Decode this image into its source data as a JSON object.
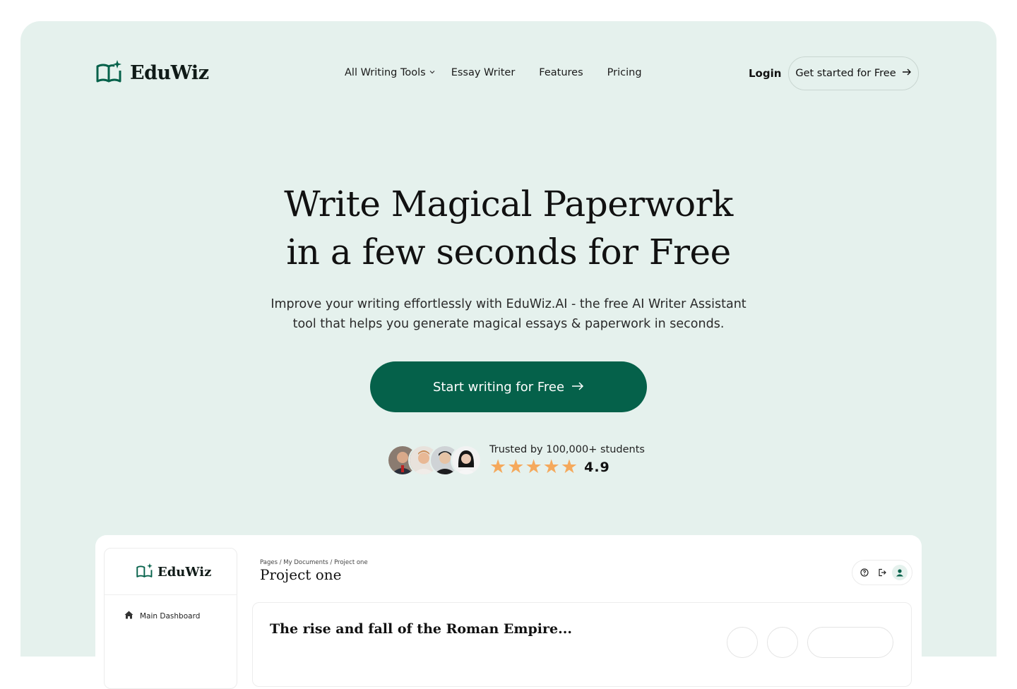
{
  "brand": {
    "name": "EduWiz",
    "accent": "#05614a",
    "hero_bg": "#e5f1ed",
    "star_color": "#f5a95c"
  },
  "nav": {
    "items": [
      {
        "label": "All Writing Tools",
        "has_dropdown": true
      },
      {
        "label": "Essay Writer"
      },
      {
        "label": "Features"
      },
      {
        "label": "Pricing"
      }
    ],
    "login_label": "Login",
    "cta_label": "Get started for Free"
  },
  "hero": {
    "headline_line1": "Write Magical Paperwork",
    "headline_line2": "in a few seconds for Free",
    "subtitle_line1": "Improve your writing effortlessly with EduWiz.AI - the free AI Writer Assistant",
    "subtitle_line2": "tool that helps you generate magical essays & paperwork in seconds.",
    "cta_label": "Start writing for Free"
  },
  "trust": {
    "text": "Trusted by 100,000+ students",
    "rating": "4.9",
    "stars": 5,
    "avatars": [
      "avatar-1",
      "avatar-2",
      "avatar-3",
      "avatar-4"
    ]
  },
  "preview": {
    "sidebar": {
      "brand": "EduWiz",
      "items": [
        {
          "label": "Main Dashboard",
          "icon": "home-icon"
        }
      ]
    },
    "breadcrumb": "Pages / My Documents / Project one",
    "page_title": "Project one",
    "document_title": "The rise and fall of the Roman Empire..."
  }
}
